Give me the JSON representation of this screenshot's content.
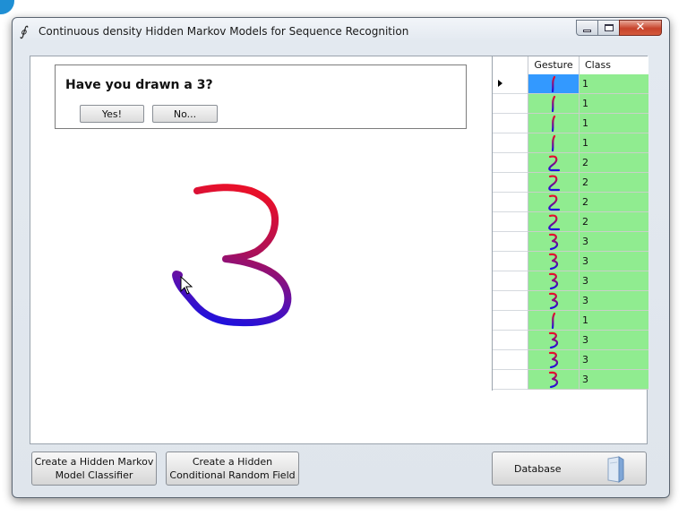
{
  "window": {
    "title": "Continuous density Hidden Markov Models for Sequence Recognition",
    "app_icon": "∮"
  },
  "prompt": {
    "question": "Have you drawn a 3?",
    "yes_label": "Yes!",
    "no_label": "No..."
  },
  "grid": {
    "headers": {
      "gesture": "Gesture",
      "class": "Class"
    },
    "rows": [
      {
        "gesture_icon": "digit-1-gesture",
        "class": "1",
        "selected": true
      },
      {
        "gesture_icon": "digit-1-gesture",
        "class": "1"
      },
      {
        "gesture_icon": "digit-1-gesture",
        "class": "1"
      },
      {
        "gesture_icon": "digit-1-gesture",
        "class": "1"
      },
      {
        "gesture_icon": "digit-2-gesture",
        "class": "2"
      },
      {
        "gesture_icon": "digit-2-gesture",
        "class": "2"
      },
      {
        "gesture_icon": "digit-2-gesture",
        "class": "2"
      },
      {
        "gesture_icon": "digit-2-gesture",
        "class": "2"
      },
      {
        "gesture_icon": "digit-3-gesture",
        "class": "3"
      },
      {
        "gesture_icon": "digit-3-gesture",
        "class": "3"
      },
      {
        "gesture_icon": "digit-3-gesture",
        "class": "3"
      },
      {
        "gesture_icon": "digit-3-gesture",
        "class": "3"
      },
      {
        "gesture_icon": "digit-1-gesture",
        "class": "1"
      },
      {
        "gesture_icon": "digit-3-gesture",
        "class": "3"
      },
      {
        "gesture_icon": "digit-3-gesture",
        "class": "3"
      },
      {
        "gesture_icon": "digit-3-gesture",
        "class": "3"
      }
    ],
    "row_bg_color": "#90ec90",
    "selected_color": "#3399ff"
  },
  "buttons": {
    "hmm": "Create a Hidden Markov Model Classifier",
    "hcrf": "Create a Hidden Conditional Random Field",
    "database": "Database"
  },
  "colors": {
    "stroke_start": "#e8102a",
    "stroke_end": "#1a10e0"
  }
}
